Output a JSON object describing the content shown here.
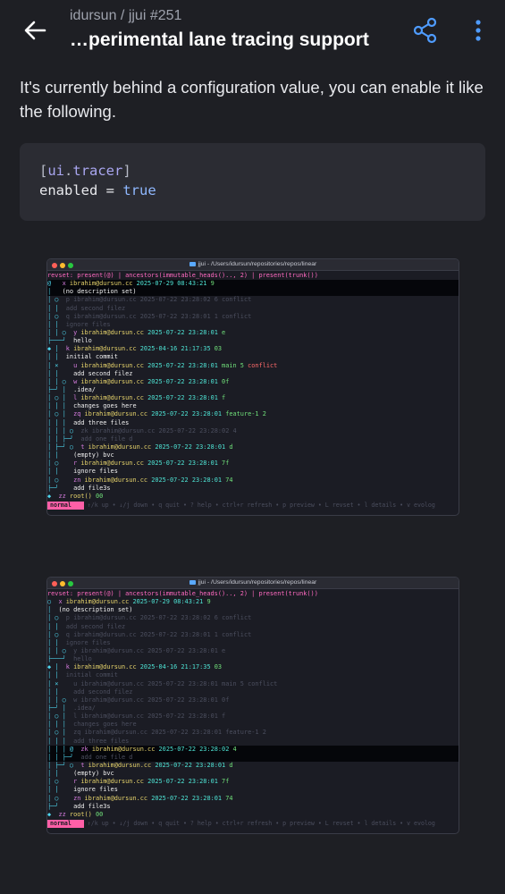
{
  "header": {
    "back_label": "←",
    "subtitle": "idursun / jjui #251",
    "title": "…perimental lane tracing support"
  },
  "body": {
    "paragraph": "It's currently behind a configuration value, you can enable it like the following."
  },
  "code": {
    "line1_open": "[",
    "line1_section": "ui",
    "line1_dot": ".",
    "line1_key": "tracer",
    "line1_close": "]",
    "line2_key": "enabled",
    "line2_eq": " = ",
    "line2_val": "true"
  },
  "terminal1": {
    "title": "jjui - /Users/idursun/repositories/repos/linear",
    "revset": "revset: present(@) | ancestors(immutable_heads().., 2) | present(trunk())",
    "lines": [
      {
        "g": "@  ",
        "id": "x",
        "email": "ibrahim@dursun.cc",
        "ts": "2025-07-29 08:43:21",
        "hash": "9",
        "tags": "",
        "desc": ""
      },
      {
        "g": "│  ",
        "id": "",
        "email": "",
        "ts": "",
        "hash": "",
        "tags": "",
        "desc": "(no description set)"
      },
      {
        "g": "│ ○ ",
        "id": "p",
        "email": "ibrahim@dursun.cc",
        "ts": "2025-07-22 23:28:02",
        "hash": "6",
        "tags": "conflict",
        "desc": ""
      },
      {
        "g": "│ │ ",
        "id": "",
        "email": "",
        "ts": "",
        "hash": "",
        "tags": "",
        "desc": "add second filez"
      },
      {
        "g": "│ ○ ",
        "id": "q",
        "email": "ibrahim@dursun.cc",
        "ts": "2025-07-22 23:28:01",
        "hash": "1",
        "tags": "conflict",
        "desc": ""
      },
      {
        "g": "│ │ ",
        "id": "",
        "email": "",
        "ts": "",
        "hash": "",
        "tags": "",
        "desc": "ignore files"
      },
      {
        "g": "│ │ ○ ",
        "id": "y",
        "email": "ibrahim@dursun.cc",
        "ts": "2025-07-22 23:28:01",
        "hash": "e",
        "tags": "",
        "desc": ""
      },
      {
        "g": "├───╯ ",
        "id": "",
        "email": "",
        "ts": "",
        "hash": "",
        "tags": "",
        "desc": "hello"
      },
      {
        "g": "◆ │ ",
        "id": "k",
        "email": "ibrahim@dursun.cc",
        "ts": "2025-04-16 21:17:35",
        "hash": "03",
        "tags": "",
        "desc": ""
      },
      {
        "g": "│ │ ",
        "id": "",
        "email": "",
        "ts": "",
        "hash": "",
        "tags": "",
        "desc": "initial commit"
      },
      {
        "g": "│ ×   ",
        "id": "u",
        "email": "ibrahim@dursun.cc",
        "ts": "2025-07-22 23:28:01",
        "hash": "main 5",
        "tags": "conflict",
        "desc": ""
      },
      {
        "g": "│ │   ",
        "id": "",
        "email": "",
        "ts": "",
        "hash": "",
        "tags": "",
        "desc": "add second filez"
      },
      {
        "g": "│ │ ○ ",
        "id": "w",
        "email": "ibrahim@dursun.cc",
        "ts": "2025-07-22 23:28:01",
        "hash": "0f",
        "tags": "",
        "desc": ""
      },
      {
        "g": "├─╯ │ ",
        "id": "",
        "email": "",
        "ts": "",
        "hash": "",
        "tags": "",
        "desc": ".idea/"
      },
      {
        "g": "│ ○ │ ",
        "id": "l",
        "email": "ibrahim@dursun.cc",
        "ts": "2025-07-22 23:28:01",
        "hash": "f",
        "tags": "",
        "desc": ""
      },
      {
        "g": "│ │ │ ",
        "id": "",
        "email": "",
        "ts": "",
        "hash": "",
        "tags": "",
        "desc": "changes goes here"
      },
      {
        "g": "│ ○ │ ",
        "id": "zq",
        "email": "ibrahim@dursun.cc",
        "ts": "2025-07-22 23:28:01",
        "hash": "feature-1 2",
        "tags": "",
        "desc": ""
      },
      {
        "g": "│ │ │ ",
        "id": "",
        "email": "",
        "ts": "",
        "hash": "",
        "tags": "",
        "desc": "add three files"
      },
      {
        "g": "│ │ │ ○ ",
        "id": "zk",
        "email": "ibrahim@dursun.cc",
        "ts": "2025-07-22 23:28:02",
        "hash": "4",
        "tags": "",
        "desc": ""
      },
      {
        "g": "│ │ ├─╯ ",
        "id": "",
        "email": "",
        "ts": "",
        "hash": "",
        "tags": "",
        "desc": "add one file d"
      },
      {
        "g": "│ ├─╯ ○ ",
        "id": "t",
        "email": "ibrahim@dursun.cc",
        "ts": "2025-07-22 23:28:01",
        "hash": "d",
        "tags": "",
        "desc": ""
      },
      {
        "g": "│ │   ",
        "id": "",
        "email": "",
        "ts": "",
        "hash": "",
        "tags": "",
        "desc": "(empty) bvc"
      },
      {
        "g": "│ ○   ",
        "id": "r",
        "email": "ibrahim@dursun.cc",
        "ts": "2025-07-22 23:28:01",
        "hash": "7f",
        "tags": "",
        "desc": ""
      },
      {
        "g": "│ │   ",
        "id": "",
        "email": "",
        "ts": "",
        "hash": "",
        "tags": "",
        "desc": "ignore files"
      },
      {
        "g": "│ ○   ",
        "id": "zn",
        "email": "ibrahim@dursun.cc",
        "ts": "2025-07-22 23:28:01",
        "hash": "74",
        "tags": "",
        "desc": ""
      },
      {
        "g": "├─╯   ",
        "id": "",
        "email": "",
        "ts": "",
        "hash": "",
        "tags": "",
        "desc": "add file3s"
      },
      {
        "g": "◆ ",
        "id": "zz",
        "email": "root()",
        "ts": "",
        "hash": "00",
        "tags": "",
        "desc": ""
      }
    ],
    "mode": "normal",
    "status": "↑/k up • ↓/j down • q quit • ? help • ctrl+r refresh • p preview • L revset • l details • v evolog"
  },
  "terminal2": {
    "title": "jjui - /Users/idursun/repositories/repos/linear",
    "revset": "revset: present(@) | ancestors(immutable_heads().., 2) | present(trunk())",
    "lines": [
      {
        "g": "○ ",
        "id": "x",
        "email": "ibrahim@dursun.cc",
        "ts": "2025-07-29 08:43:21",
        "hash": "9",
        "tags": "",
        "desc": ""
      },
      {
        "g": "│ ",
        "id": "",
        "email": "",
        "ts": "",
        "hash": "",
        "tags": "",
        "desc": "(no description set)"
      },
      {
        "g": "│ ○ ",
        "id": "p",
        "email": "ibrahim@dursun.cc",
        "ts": "2025-07-22 23:28:02",
        "hash": "6",
        "tags": "conflict",
        "desc": ""
      },
      {
        "g": "│ │ ",
        "id": "",
        "email": "",
        "ts": "",
        "hash": "",
        "tags": "",
        "desc": "add second filez"
      },
      {
        "g": "│ ○ ",
        "id": "q",
        "email": "ibrahim@dursun.cc",
        "ts": "2025-07-22 23:28:01",
        "hash": "1",
        "tags": "conflict",
        "desc": ""
      },
      {
        "g": "│ │ ",
        "id": "",
        "email": "",
        "ts": "",
        "hash": "",
        "tags": "",
        "desc": "ignore files"
      },
      {
        "g": "│ │ ○ ",
        "id": "y",
        "email": "ibrahim@dursun.cc",
        "ts": "2025-07-22 23:28:01",
        "hash": "e",
        "tags": "",
        "desc": ""
      },
      {
        "g": "├───╯ ",
        "id": "",
        "email": "",
        "ts": "",
        "hash": "",
        "tags": "",
        "desc": "hello"
      },
      {
        "g": "◆ │ ",
        "id": "k",
        "email": "ibrahim@dursun.cc",
        "ts": "2025-04-16 21:17:35",
        "hash": "03",
        "tags": "",
        "desc": ""
      },
      {
        "g": "│ │ ",
        "id": "",
        "email": "",
        "ts": "",
        "hash": "",
        "tags": "",
        "desc": "initial commit"
      },
      {
        "g": "│ ×   ",
        "id": "u",
        "email": "ibrahim@dursun.cc",
        "ts": "2025-07-22 23:28:01",
        "hash": "main 5",
        "tags": "conflict",
        "desc": ""
      },
      {
        "g": "│ │   ",
        "id": "",
        "email": "",
        "ts": "",
        "hash": "",
        "tags": "",
        "desc": "add second filez"
      },
      {
        "g": "│ │ ○ ",
        "id": "w",
        "email": "ibrahim@dursun.cc",
        "ts": "2025-07-22 23:28:01",
        "hash": "0f",
        "tags": "",
        "desc": ""
      },
      {
        "g": "├─╯ │ ",
        "id": "",
        "email": "",
        "ts": "",
        "hash": "",
        "tags": "",
        "desc": ".idea/"
      },
      {
        "g": "│ ○ │ ",
        "id": "l",
        "email": "ibrahim@dursun.cc",
        "ts": "2025-07-22 23:28:01",
        "hash": "f",
        "tags": "",
        "desc": ""
      },
      {
        "g": "│ │ │ ",
        "id": "",
        "email": "",
        "ts": "",
        "hash": "",
        "tags": "",
        "desc": "changes goes here"
      },
      {
        "g": "│ ○ │ ",
        "id": "zq",
        "email": "ibrahim@dursun.cc",
        "ts": "2025-07-22 23:28:01",
        "hash": "feature-1 2",
        "tags": "",
        "desc": ""
      },
      {
        "g": "│ │ │ ",
        "id": "",
        "email": "",
        "ts": "",
        "hash": "",
        "tags": "",
        "desc": "add three files"
      },
      {
        "g": "│ │ │ @ ",
        "id": "zk",
        "email": "ibrahim@dursun.cc",
        "ts": "2025-07-22 23:28:02",
        "hash": "4",
        "tags": "",
        "desc": ""
      },
      {
        "g": "│ │ ├─╯ ",
        "id": "",
        "email": "",
        "ts": "",
        "hash": "",
        "tags": "",
        "desc": "add one file d"
      },
      {
        "g": "│ ├─╯ ○ ",
        "id": "t",
        "email": "ibrahim@dursun.cc",
        "ts": "2025-07-22 23:28:01",
        "hash": "d",
        "tags": "",
        "desc": ""
      },
      {
        "g": "│ │   ",
        "id": "",
        "email": "",
        "ts": "",
        "hash": "",
        "tags": "",
        "desc": "(empty) bvc"
      },
      {
        "g": "│ ○   ",
        "id": "r",
        "email": "ibrahim@dursun.cc",
        "ts": "2025-07-22 23:28:01",
        "hash": "7f",
        "tags": "",
        "desc": ""
      },
      {
        "g": "│ │   ",
        "id": "",
        "email": "",
        "ts": "",
        "hash": "",
        "tags": "",
        "desc": "ignore files"
      },
      {
        "g": "│ ○   ",
        "id": "zn",
        "email": "ibrahim@dursun.cc",
        "ts": "2025-07-22 23:28:01",
        "hash": "74",
        "tags": "",
        "desc": ""
      },
      {
        "g": "├─╯   ",
        "id": "",
        "email": "",
        "ts": "",
        "hash": "",
        "tags": "",
        "desc": "add file3s"
      },
      {
        "g": "◆ ",
        "id": "zz",
        "email": "root()",
        "ts": "",
        "hash": "00",
        "tags": "",
        "desc": ""
      }
    ],
    "mode": "normal",
    "status": "↑/k up • ↓/j down • q quit • ? help • ctrl+r refresh • p preview • L revset • l details • v evolog"
  },
  "icons": {
    "back": "arrow-left-icon",
    "share": "share-icon",
    "more": "more-vertical-icon"
  },
  "colors": {
    "background": "#1e1f24",
    "code_bg": "#2b2c33",
    "accent_pink": "#ff5fa7",
    "link_blue": "#5aa9ff"
  }
}
